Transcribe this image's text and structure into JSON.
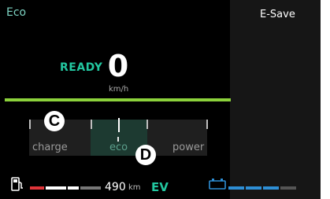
{
  "header": {
    "mode": "Eco",
    "esave": "E-Save"
  },
  "status": {
    "ready": "READY"
  },
  "speed": {
    "value": "0",
    "unit": "km/h"
  },
  "power_meter": {
    "zones": [
      "charge",
      "eco",
      "power"
    ],
    "active_zone": "eco",
    "markers": [
      "C",
      "D"
    ]
  },
  "bottom": {
    "range_value": "490",
    "range_unit": "km",
    "drive_mode": "EV",
    "fuel_icon": "fuel-pump-icon",
    "battery_icon": "battery-icon"
  },
  "colors": {
    "accent": "#22c7a0",
    "green_line": "#8bd13b",
    "battery": "#2e8fd6",
    "fuel_low": "#e0353a"
  }
}
